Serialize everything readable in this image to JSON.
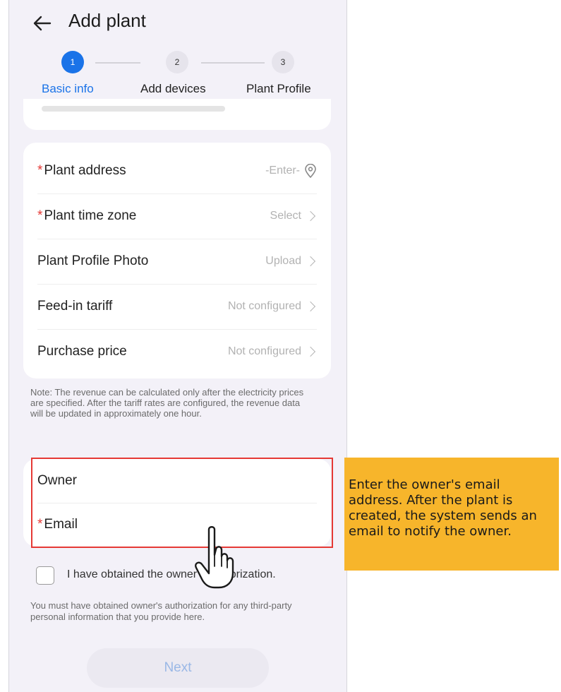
{
  "header": {
    "title": "Add plant"
  },
  "steps": [
    {
      "number": "1",
      "label": "Basic info"
    },
    {
      "number": "2",
      "label": "Add devices"
    },
    {
      "number": "3",
      "label": "Plant Profile"
    }
  ],
  "fields": {
    "plant_address": {
      "label": "Plant address",
      "required": "*",
      "value": "-Enter-"
    },
    "time_zone": {
      "label": "Plant time zone",
      "required": "*",
      "value": "Select"
    },
    "profile_photo": {
      "label": "Plant Profile Photo",
      "value": "Upload"
    },
    "feed_in_tariff": {
      "label": "Feed-in tariff",
      "value": "Not configured"
    },
    "purchase_price": {
      "label": "Purchase price",
      "value": "Not configured"
    }
  },
  "note": "Note: The revenue can be calculated only after the electricity prices are specified. After the tariff rates are configured, the revenue data will be updated in approximately one hour.",
  "owner": {
    "section_label": "Owner",
    "email_label": "Email",
    "email_required": "*"
  },
  "authorization": {
    "checkbox_label": "I have obtained the owner's authorization.",
    "checked": false,
    "disclaimer": "You must have obtained owner's authorization for any third-party personal information that you provide here."
  },
  "next_button": "Next",
  "callout": {
    "text": "Enter the owner's email address. After the plant is created, the system sends an email to notify the owner."
  },
  "colors": {
    "accent": "#1a73e8",
    "required": "#e53935",
    "highlight_border": "#e53935",
    "callout_bg": "#f7b52b"
  }
}
